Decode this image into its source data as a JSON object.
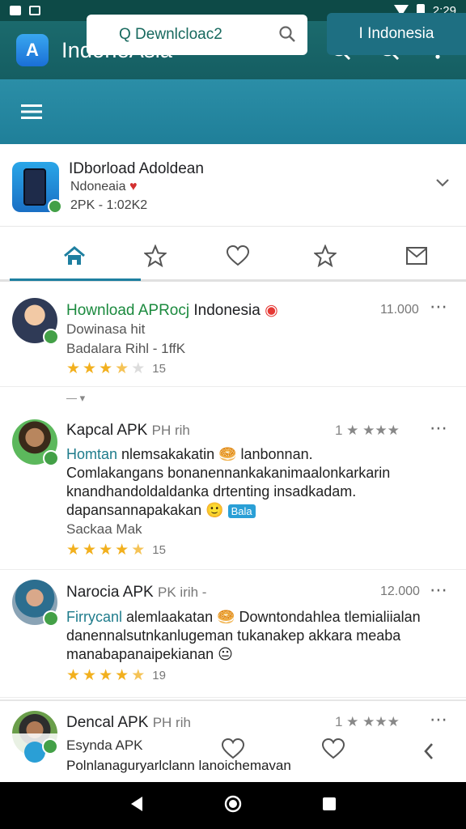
{
  "status_bar": {
    "time": "2:29"
  },
  "app_bar": {
    "title": "IndoneAsia"
  },
  "search": {
    "text": "Q Dewnlcloac2",
    "country": "I Indonesia"
  },
  "app_card": {
    "title": "IDborload Adoldean",
    "subtitle": "Ndoneaia",
    "meta": "2PK - 1:02K2"
  },
  "tabs": [
    "home-tab",
    "star-tab",
    "heart-tab",
    "star-tab-2",
    "mail-tab"
  ],
  "reviews": [
    {
      "title_colored": "Hownload APRocj",
      "title_rest": " Indonesia",
      "count": "11.000",
      "line1": "Dowinasa hit",
      "line2": "Badalara Rihl - 1ffK",
      "rating_count": "15",
      "stars_full": 3,
      "stars_half": 1
    },
    {
      "title": "Kapcal APK",
      "title_suffix": "PH rih",
      "rating_text": "1 ★ ★★★",
      "line1_colored": "Homtan",
      "line1_rest": " nlemsakakatin 🥯 lanbonnan.",
      "line2": "Comlakangans bonanennankakanimaalonkarkarin",
      "line3": "knandhandoldaldanka drtenting insadkadam.",
      "line4": "dapansannapakakan 🙂",
      "tag": "Bala",
      "line5": "Sackaa Mak",
      "rating_count": "15",
      "stars_full": 5
    },
    {
      "title": "Narocia APK",
      "title_suffix": "PK irih -",
      "count": "12.000",
      "line1_colored": "Firrycanl",
      "line1_rest": " alemlaakatan 🥯 Downtondahlea tlemialiialan",
      "line2": "danennalsutnkanlugeman tukanakep akkara meaba",
      "line3": "manabapanaipekianan 😐",
      "rating_count": "19",
      "stars_full": 5
    },
    {
      "title": "Dencal APK",
      "title_suffix": "PH rih",
      "rating_text": "1 ★ ★★★",
      "line1": "Esynda APK",
      "line2": "Polnlanaguryarlclann lanoichemavan"
    }
  ],
  "colors": {
    "app_bar": "#155e62",
    "search_band": "#2b8ea7",
    "accent": "#1e7fa0",
    "star": "#f2b01e",
    "verified": "#43a047"
  }
}
